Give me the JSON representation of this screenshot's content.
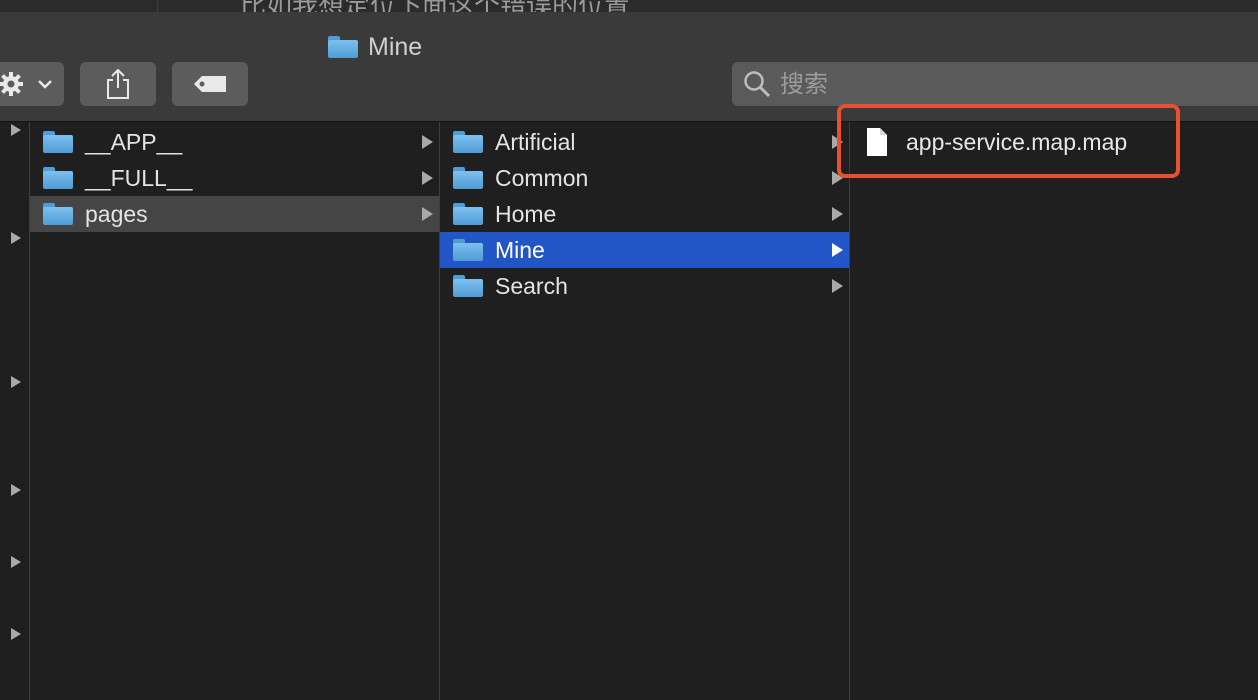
{
  "window": {
    "title": "Mine",
    "background_text": "比如我想定位下面这个错误的位置"
  },
  "toolbar": {
    "action_icon": "gear-icon",
    "share_icon": "share-icon",
    "tag_icon": "tag-icon"
  },
  "search": {
    "placeholder": "搜索",
    "value": ""
  },
  "column1": {
    "items": [
      {
        "label": "__APP__"
      },
      {
        "label": "__FULL__"
      },
      {
        "label": "pages"
      }
    ]
  },
  "column2": {
    "items": [
      {
        "label": "Artificial"
      },
      {
        "label": "Common"
      },
      {
        "label": "Home"
      },
      {
        "label": "Mine"
      },
      {
        "label": "Search"
      }
    ]
  },
  "column3": {
    "items": [
      {
        "label": "app-service.map.map"
      }
    ]
  },
  "colors": {
    "selection": "#2255c6",
    "highlight": "#e8502f",
    "folder": "#4f9cd6"
  }
}
